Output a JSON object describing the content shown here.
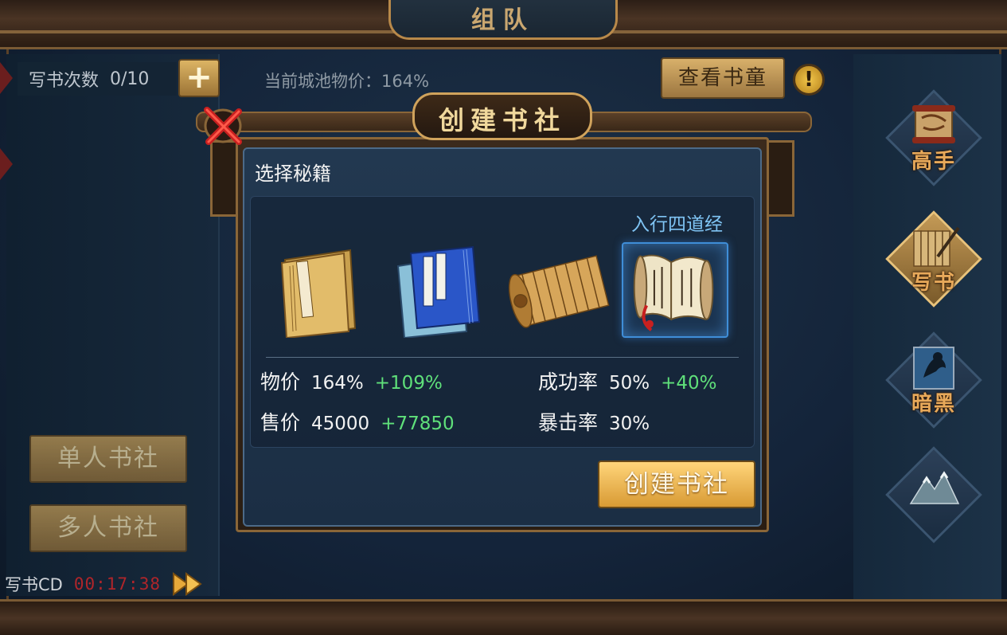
{
  "header": {
    "title": "组队"
  },
  "top_bar": {
    "write_count_label": "写书次数",
    "write_count_value": "0/10",
    "plus_label": "+",
    "city_price": "当前城池物价：164%",
    "view_button": "查看书童",
    "info_label": "!"
  },
  "left_panel": {
    "single_button": "单人书社",
    "multi_button": "多人书社",
    "cd_label": "写书CD",
    "cd_time": "00:17:38"
  },
  "right_panel": {
    "items": [
      {
        "label": "高手",
        "icon": "scroll-icon",
        "active": false
      },
      {
        "label": "写书",
        "icon": "bamboo-scroll-icon",
        "active": true
      },
      {
        "label": "暗黑",
        "icon": "dark-warrior-icon",
        "active": false
      },
      {
        "label": "",
        "icon": "mountain-icon",
        "active": false
      }
    ]
  },
  "dialog": {
    "title": "创建书社",
    "section_label": "选择秘籍",
    "selected_book_name": "入行四道经",
    "books": [
      {
        "icon": "yellow-book-icon",
        "selected": false
      },
      {
        "icon": "blue-book-icon",
        "selected": false
      },
      {
        "icon": "bamboo-scroll-icon",
        "selected": false
      },
      {
        "icon": "paper-scroll-icon",
        "selected": true
      }
    ],
    "stats": {
      "price_label": "物价",
      "price_value": "164%",
      "price_delta": "+109%",
      "success_label": "成功率",
      "success_value": "50%",
      "success_delta": "+40%",
      "sell_label": "售价",
      "sell_value": "45000",
      "sell_delta": "+77850",
      "crit_label": "暴击率",
      "crit_value": "30%"
    },
    "create_button": "创建书社"
  },
  "colors": {
    "accent_gold": "#d89a34",
    "positive_delta": "#5fe07a",
    "cd_red": "#b0252a",
    "book_name_blue": "#7fc4f4"
  }
}
